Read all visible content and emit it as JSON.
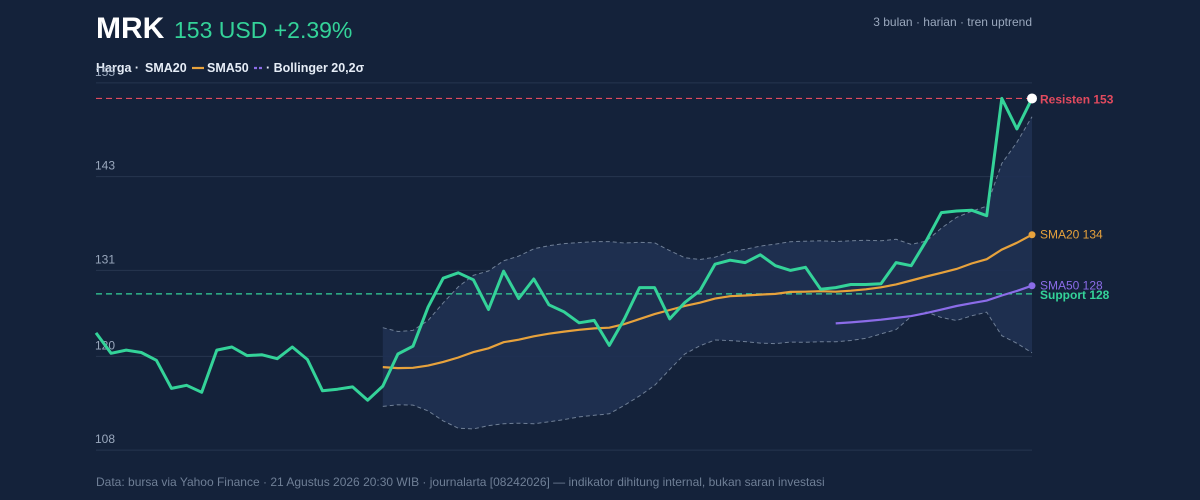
{
  "header": {
    "ticker": "MRK",
    "price_change": "153 USD +2.39%",
    "meta": "3 bulan · harian · tren uptrend"
  },
  "legend": {
    "harga": "Harga ·",
    "sma20": "SMA20",
    "sma50": "SMA50",
    "bollinger": "· Bollinger 20,2σ"
  },
  "footer": "Data: bursa via Yahoo Finance · 21 Agustus 2026 20:30 WIB · journalarta [08242026] — indikator dihitung internal, bukan saran investasi",
  "colors": {
    "background": "#14223a",
    "price": "#34d399",
    "sma20": "#e7a23c",
    "sma50": "#8b6ce8",
    "band": "#6f7f96",
    "resistance": "#e24a5e",
    "support": "#34d399"
  },
  "chart_data": {
    "type": "line",
    "ylim": [
      107,
      156
    ],
    "yticks": [
      108,
      120,
      131,
      143,
      155
    ],
    "grid": true,
    "x": [
      0,
      1,
      2,
      3,
      4,
      5,
      6,
      7,
      8,
      9,
      10,
      11,
      12,
      13,
      14,
      15,
      16,
      17,
      18,
      19,
      20,
      21,
      22,
      23,
      24,
      25,
      26,
      27,
      28,
      29,
      30,
      31,
      32,
      33,
      34,
      35,
      36,
      37,
      38,
      39,
      40,
      41,
      42,
      43,
      44,
      45,
      46,
      47,
      48,
      49,
      50,
      51,
      52,
      53,
      54,
      55,
      56,
      57,
      58
    ],
    "series": [
      {
        "name": "Harga",
        "values": [
          123.0,
          120.4,
          120.8,
          120.5,
          119.5,
          115.9,
          116.3,
          115.4,
          120.8,
          121.2,
          120.1,
          120.2,
          119.7,
          121.2,
          119.6,
          115.6,
          115.8,
          116.1,
          114.4,
          116.2,
          120.3,
          121.3,
          126.3,
          130.0,
          130.7,
          129.8,
          126.0,
          130.9,
          127.4,
          129.9,
          126.6,
          125.7,
          124.3,
          124.6,
          121.4,
          124.8,
          128.8,
          128.8,
          124.8,
          126.9,
          128.4,
          131.8,
          132.3,
          132.0,
          133.0,
          131.6,
          131.0,
          131.4,
          128.6,
          128.8,
          129.2,
          129.2,
          129.3,
          132.0,
          131.6,
          134.8,
          138.4,
          138.6,
          138.7,
          138.0,
          153.0,
          149.1,
          153.0
        ]
      },
      {
        "name": "SMA20",
        "values": []
      },
      {
        "name": "SMA50",
        "values": []
      }
    ],
    "levels": [
      {
        "name": "Resisten",
        "value": 153,
        "label": "Resisten 153"
      },
      {
        "name": "Support",
        "value": 128,
        "label": "Support 128"
      }
    ],
    "end_labels": {
      "sma20": "SMA20 134",
      "sma50": "SMA50 128"
    }
  }
}
